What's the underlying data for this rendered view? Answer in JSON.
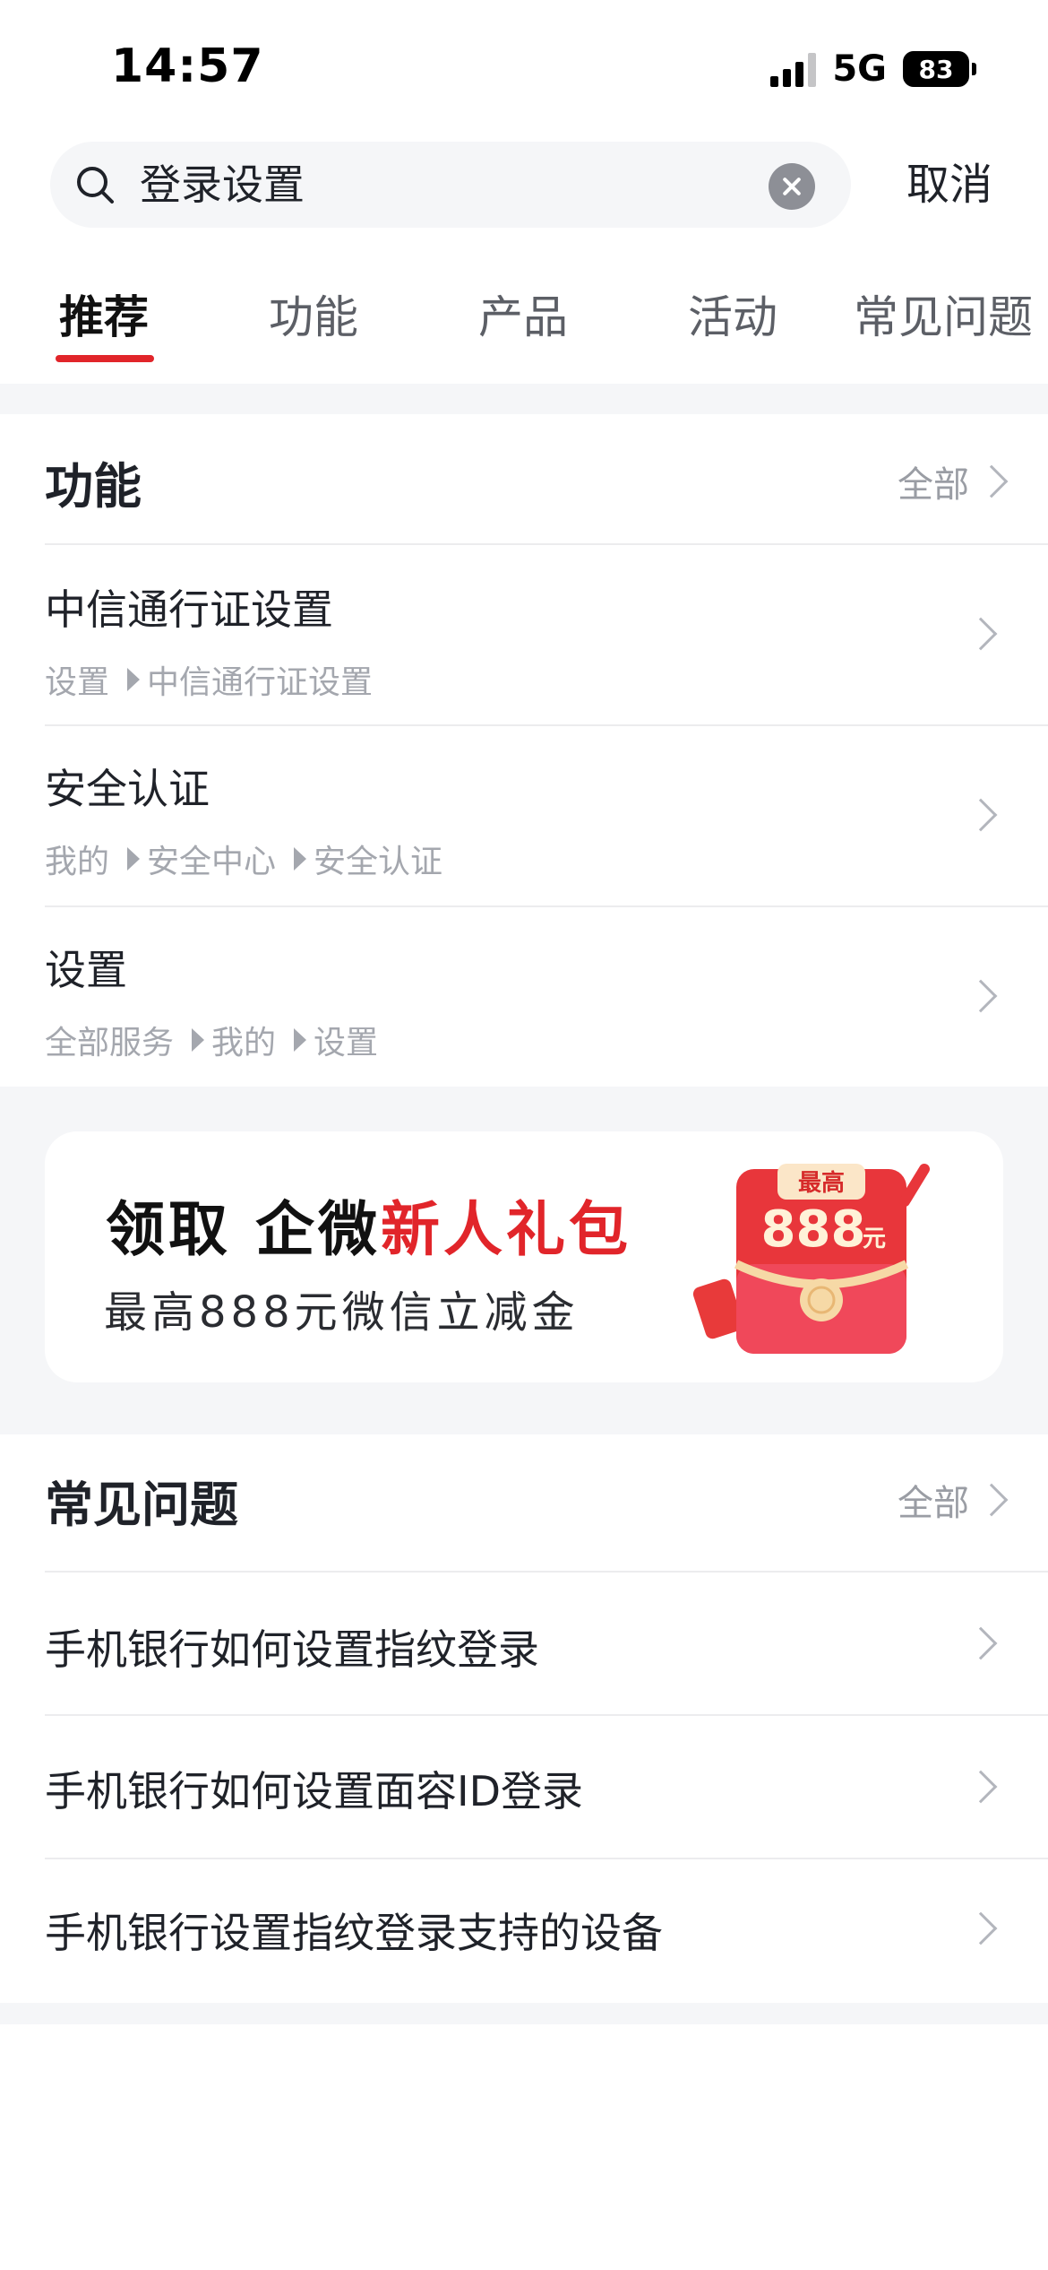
{
  "status_bar": {
    "time": "14:57",
    "network": "5G",
    "battery": "83"
  },
  "search": {
    "query": "登录设置",
    "cancel_label": "取消"
  },
  "tabs": [
    {
      "label": "推荐",
      "active": true
    },
    {
      "label": "功能",
      "active": false
    },
    {
      "label": "产品",
      "active": false
    },
    {
      "label": "活动",
      "active": false
    },
    {
      "label": "常见问题",
      "active": false
    }
  ],
  "functions": {
    "title": "功能",
    "all_label": "全部",
    "items": [
      {
        "title": "中信通行证设置",
        "path": [
          "设置",
          "中信通行证设置"
        ]
      },
      {
        "title": "安全认证",
        "path": [
          "我的",
          "安全中心",
          "安全认证"
        ]
      },
      {
        "title": "设置",
        "path": [
          "全部服务",
          "我的",
          "设置"
        ]
      }
    ]
  },
  "banner": {
    "line1_prefix": "领取 企微",
    "line1_highlight": "新人礼包",
    "line2": "最高888元微信立减金",
    "envelope_tag": "最高",
    "envelope_amount": "888",
    "envelope_unit": "元",
    "colors": {
      "highlight": "#e1252a",
      "envelope": "#e83a3a"
    }
  },
  "faq": {
    "title": "常见问题",
    "all_label": "全部",
    "items": [
      "手机银行如何设置指纹登录",
      "手机银行如何设置面容ID登录",
      "手机银行设置指纹登录支持的设备"
    ]
  },
  "colors": {
    "accent": "#e1252a",
    "background": "#f5f6f8"
  }
}
